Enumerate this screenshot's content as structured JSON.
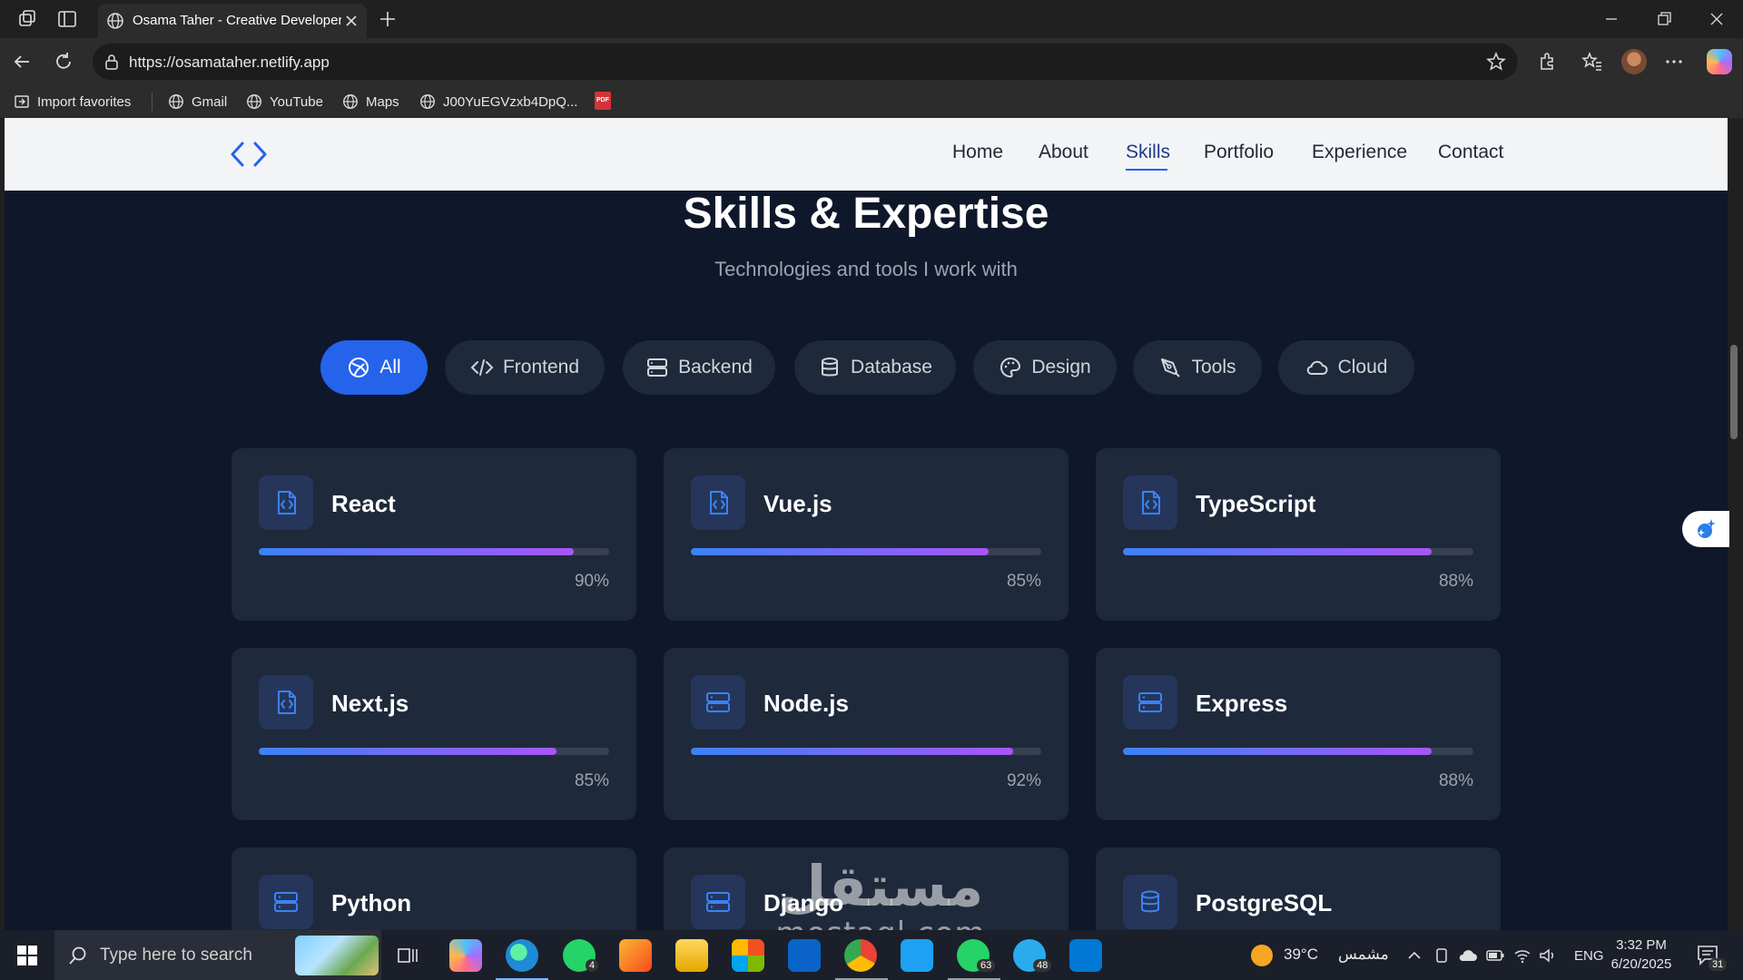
{
  "browser": {
    "tab_title": "Osama Taher - Creative Developer",
    "url": "https://osamataher.netlify.app",
    "bookmarks": [
      "Import favorites",
      "Gmail",
      "YouTube",
      "Maps",
      "J00YuEGVzxb4DpQ..."
    ],
    "pdf_label": "PDF"
  },
  "site": {
    "nav": [
      "Home",
      "About",
      "Skills",
      "Portfolio",
      "Experience",
      "Contact"
    ],
    "active_nav": "Skills",
    "heading": "Skills & Expertise",
    "subheading": "Technologies and tools I work with",
    "filters": [
      {
        "label": "All",
        "icon": "globe-icon",
        "active": true
      },
      {
        "label": "Frontend",
        "icon": "code-icon"
      },
      {
        "label": "Backend",
        "icon": "server-icon"
      },
      {
        "label": "Database",
        "icon": "database-icon"
      },
      {
        "label": "Design",
        "icon": "palette-icon"
      },
      {
        "label": "Tools",
        "icon": "pen-tool-icon"
      },
      {
        "label": "Cloud",
        "icon": "cloud-icon"
      }
    ],
    "skills": [
      {
        "name": "React",
        "level": 90,
        "level_label": "90%",
        "icon": "file-code-icon"
      },
      {
        "name": "Vue.js",
        "level": 85,
        "level_label": "85%",
        "icon": "file-code-icon"
      },
      {
        "name": "TypeScript",
        "level": 88,
        "level_label": "88%",
        "icon": "file-code-icon"
      },
      {
        "name": "Next.js",
        "level": 85,
        "level_label": "85%",
        "icon": "file-code-icon"
      },
      {
        "name": "Node.js",
        "level": 92,
        "level_label": "92%",
        "icon": "server-icon"
      },
      {
        "name": "Express",
        "level": 88,
        "level_label": "88%",
        "icon": "server-icon"
      },
      {
        "name": "Python",
        "icon": "server-icon"
      },
      {
        "name": "Django",
        "icon": "server-icon"
      },
      {
        "name": "PostgreSQL",
        "icon": "database-icon"
      }
    ]
  },
  "watermark": {
    "arabic": "مستقل",
    "latin": "mostaql.com"
  },
  "taskbar": {
    "search_placeholder": "Type here to search",
    "whatsapp_count": "4",
    "bluesky_whatsapp_count": "63",
    "telegram_count": "48",
    "weather": "39°C",
    "weather_desc": "مشمس",
    "language": "ENG",
    "time": "3:32 PM",
    "date": "6/20/2025",
    "notifications": "31"
  },
  "colors": {
    "accent": "#2563eb",
    "page_bg": "#0f172a",
    "card_bg": "#1e293b",
    "bar_start": "#3b82f6",
    "bar_end": "#a855f7"
  }
}
